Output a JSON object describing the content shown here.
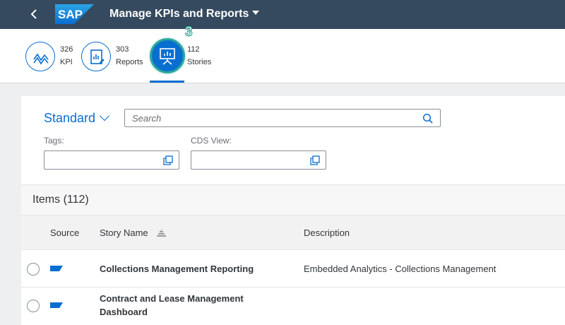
{
  "shell": {
    "logo_text": "SAP",
    "title": "Manage KPIs and Reports"
  },
  "kpi_tiles": [
    {
      "count": "326",
      "label": "KPI",
      "icon": "kpi-trend-icon"
    },
    {
      "count": "303",
      "label": "Reports",
      "icon": "report-icon"
    },
    {
      "count": "112",
      "label": "Stories",
      "icon": "story-presentation-icon",
      "selected": true
    }
  ],
  "step_badge": "3",
  "filter": {
    "variant": "Standard",
    "search_placeholder": "Search",
    "tags_label": "Tags:",
    "cds_label": "CDS View:"
  },
  "table": {
    "title": "Items (112)",
    "columns": [
      "Source",
      "Story Name",
      "Description"
    ],
    "rows": [
      {
        "name": "Collections Management Reporting",
        "description": "Embedded Analytics - Collections Management"
      },
      {
        "name_line1": "Contract and Lease Management",
        "name_line2": "Dashboard",
        "description": ""
      }
    ]
  },
  "colors": {
    "shell": "#354a5f",
    "accent": "#0a6ed1",
    "highlight": "#2aa99b"
  }
}
